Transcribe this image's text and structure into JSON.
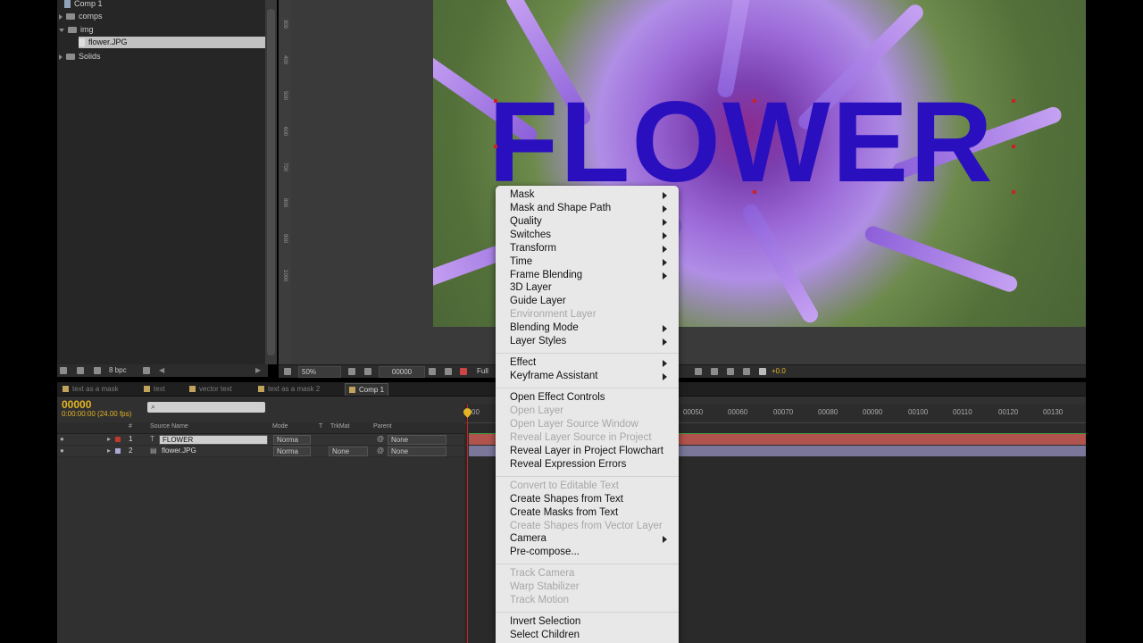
{
  "project": {
    "items": [
      {
        "label": "Comp 1",
        "kind": "comp"
      },
      {
        "label": "comps",
        "kind": "folder"
      },
      {
        "label": "img",
        "kind": "folder-open"
      },
      {
        "label": "flower.JPG",
        "kind": "file"
      },
      {
        "label": "Solids",
        "kind": "folder"
      }
    ],
    "bpc_label": "8 bpc"
  },
  "ruler": {
    "labels": [
      "300",
      "400",
      "500",
      "600",
      "700",
      "800",
      "900",
      "1000"
    ]
  },
  "viewer": {
    "text_layer": "FLOWER",
    "zoom": "50%",
    "timecode": "00000",
    "resolution": "Full",
    "exposure": "+0.0"
  },
  "tabs": [
    {
      "label": "text as a mask"
    },
    {
      "label": "text"
    },
    {
      "label": "vector text"
    },
    {
      "label": "text as a mask 2"
    },
    {
      "label": "Comp 1",
      "active": true
    }
  ],
  "timeline": {
    "timecode": "00000",
    "fps": "0:00:00:00 (24.00 fps)",
    "columns": {
      "source_name": "Source Name",
      "mode": "Mode",
      "t": "T",
      "trkmat": "TrkMat",
      "parent": "Parent",
      "num": "#"
    },
    "layers": [
      {
        "num": "1",
        "name": "FLOWER",
        "mode": "Norma",
        "trkmat": "",
        "parent": "None",
        "color": "#c0392b"
      },
      {
        "num": "2",
        "name": "flower.JPG",
        "mode": "Norma",
        "trkmat": "None",
        "parent": "None",
        "color": "#a9a9d4"
      }
    ],
    "ruler_labels": [
      "00",
      "00050",
      "00060",
      "00070",
      "00080",
      "00090",
      "00100",
      "00110",
      "00120",
      "00130"
    ]
  },
  "menu": {
    "items": [
      {
        "label": "Mask",
        "sub": true
      },
      {
        "label": "Mask and Shape Path",
        "sub": true
      },
      {
        "label": "Quality",
        "sub": true
      },
      {
        "label": "Switches",
        "sub": true
      },
      {
        "label": "Transform",
        "sub": true
      },
      {
        "label": "Time",
        "sub": true
      },
      {
        "label": "Frame Blending",
        "sub": true
      },
      {
        "label": "3D Layer"
      },
      {
        "label": "Guide Layer"
      },
      {
        "label": "Environment Layer",
        "disabled": true
      },
      {
        "label": "Blending Mode",
        "sub": true
      },
      {
        "label": "Layer Styles",
        "sub": true
      },
      {
        "label": "Effect",
        "sub": true
      },
      {
        "label": "Keyframe Assistant",
        "sub": true
      },
      {
        "label": "Open Effect Controls"
      },
      {
        "label": "Open Layer",
        "disabled": true
      },
      {
        "label": "Open Layer Source Window",
        "disabled": true
      },
      {
        "label": "Reveal Layer Source in Project",
        "disabled": true
      },
      {
        "label": "Reveal Layer in Project Flowchart"
      },
      {
        "label": "Reveal Expression Errors"
      },
      {
        "label": "Convert to Editable Text",
        "disabled": true
      },
      {
        "label": "Create Shapes from Text"
      },
      {
        "label": "Create Masks from Text"
      },
      {
        "label": "Create Shapes from Vector Layer",
        "disabled": true
      },
      {
        "label": "Camera",
        "sub": true
      },
      {
        "label": "Pre-compose..."
      },
      {
        "label": "Track Camera",
        "disabled": true
      },
      {
        "label": "Warp Stabilizer",
        "disabled": true
      },
      {
        "label": "Track Motion",
        "disabled": true
      },
      {
        "label": "Invert Selection"
      },
      {
        "label": "Select Children"
      }
    ]
  }
}
